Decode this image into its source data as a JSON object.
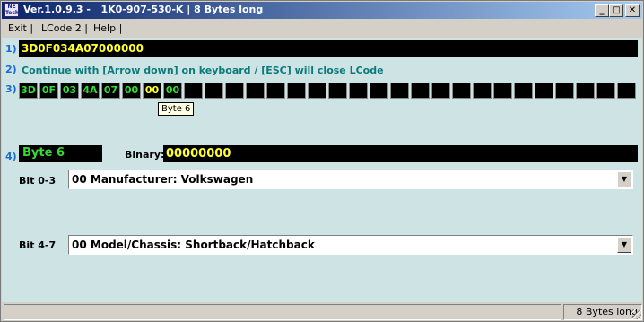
{
  "window": {
    "title": "Ver.1.0.9.3 -   1K0-907-530-K | 8 Bytes long",
    "icon_text": "NE Tech",
    "min": "_",
    "max": "□",
    "close": "✕"
  },
  "menu": [
    {
      "label": "Exit |"
    },
    {
      "label": "LCode 2 |"
    },
    {
      "label": "Help |"
    }
  ],
  "rows": {
    "r1": "1)",
    "r2": "2)",
    "r3": "3)",
    "r4": "4)"
  },
  "code_value": "3D0F034A07000000",
  "hint": "Continue with [Arrow down] on keyboard / [ESC] will close LCode",
  "bytes": [
    "3D",
    "0F",
    "03",
    "4A",
    "07",
    "00",
    "00",
    "00",
    "",
    "",
    "",
    "",
    "",
    "",
    "",
    "",
    "",
    "",
    "",
    "",
    "",
    "",
    "",
    "",
    "",
    "",
    "",
    "",
    "",
    ""
  ],
  "selected_byte_index": 6,
  "tooltip": "Byte 6",
  "byte_label": "Byte 6",
  "binary_label": "Binary:",
  "binary_value": "00000000",
  "bit03": {
    "label": "Bit 0-3",
    "value": "00 Manufacturer: Volkswagen"
  },
  "bit47": {
    "label": "Bit 4-7",
    "value": "00 Model/Chassis: Shortback/Hatchback"
  },
  "status": {
    "left": "",
    "right": "8 Bytes long"
  },
  "icons": {
    "dropdown": "dropdown-arrow-icon"
  },
  "colors": {
    "client_bg": "#cee4e4",
    "byte_text": "#33dd33",
    "highlight_text": "#ffff33",
    "hint_text": "#0c7a7a",
    "rownum_text": "#1c6fd0"
  }
}
